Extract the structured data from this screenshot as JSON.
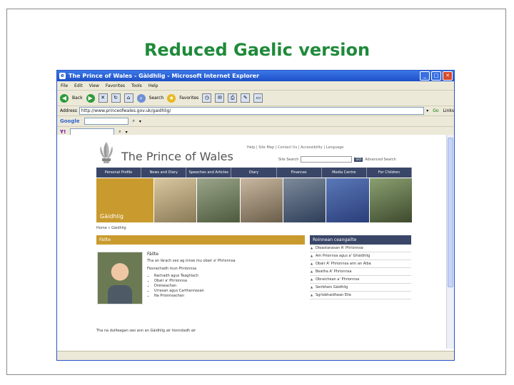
{
  "slide": {
    "title": "Reduced Gaelic version"
  },
  "browser": {
    "window_title": "The Prince of Wales - Gàidhlig - Microsoft Internet Explorer",
    "menu": [
      "File",
      "Edit",
      "View",
      "Favorites",
      "Tools",
      "Help"
    ],
    "toolbar": {
      "back": "Back",
      "search": "Search",
      "favorites": "Favorites"
    },
    "address_label": "Address",
    "address_value": "http://www.princeofwales.gov.uk/gaidhlig/",
    "go_label": "Go",
    "links_label": "Links",
    "google_label": "Google",
    "yahoo_label": "Y!",
    "status": ""
  },
  "site": {
    "name": "The Prince of Wales",
    "top_links": "Help | Site Map | Contact Us | Accessibility | Language",
    "search_label": "Site Search",
    "search_go": "GO",
    "advanced_search": "Advanced Search",
    "nav": [
      "Personal Profile",
      "News and Diary",
      "Speeches and Articles",
      "Diary",
      "Finances",
      "Media Centre",
      "For Children"
    ],
    "banner_label": "Gàidhlig",
    "breadcrumb": "Home » Gàidhlig",
    "section_title": "Fàilte",
    "article_heading": "Fàilte",
    "article_intro": "Tha an làrach seo ag innse mu obair a' Phrionnsa",
    "article_list_heading": "Fiosrachadh mun Phrionnsa",
    "article_list": [
      "Rachadh agus Teaghlach",
      "Obair a' Phrionnsa",
      "Dreiseachan",
      "Urrasan agus Carthannasan",
      "Na Prionnsachan"
    ],
    "footer_note": "Tha na duilleagan seo ann an Gàidhlig air tionndadh air",
    "related_title": "Roinnean ceangailte",
    "related_items": [
      "Dleastanasan A' Phrionnsa",
      "Am Prionnsa agus a' Ghàidhlig",
      "Obair A' Phrionnsa ann an Alba",
      "Beatha A' Phrionnsa",
      "Obraichean a' Phrionnsa",
      "Seirbheis Gàidhlig",
      "Sgrìobhaidhean Eile"
    ]
  }
}
